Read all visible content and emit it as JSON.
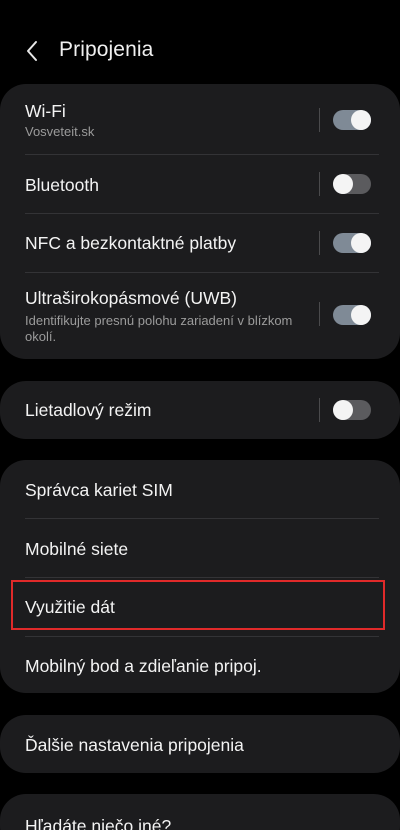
{
  "header": {
    "title": "Pripojenia",
    "back_icon": "chevron-left-icon"
  },
  "group1": {
    "wifi": {
      "label": "Wi-Fi",
      "subtitle": "Vosveteit.sk",
      "toggle": true
    },
    "bluetooth": {
      "label": "Bluetooth",
      "toggle": false
    },
    "nfc": {
      "label": "NFC a bezkontaktné platby",
      "toggle": true
    },
    "uwb": {
      "label": "Ultraširokopásmové (UWB)",
      "subtitle_line1": "Identifikujte presnú polohu zariadení v blízkom",
      "subtitle_line2": "okolí.",
      "toggle": true
    }
  },
  "group2": {
    "airplane": {
      "label": "Lietadlový režim",
      "toggle": false
    }
  },
  "group3": {
    "items": [
      {
        "label": "Správca kariet SIM"
      },
      {
        "label": "Mobilné siete"
      },
      {
        "label": "Využitie dát",
        "highlighted": true
      },
      {
        "label": "Mobilný bod a zdieľanie pripoj."
      }
    ]
  },
  "group4": {
    "more": {
      "label": "Ďalšie nastavenia pripojenia"
    }
  },
  "group5": {
    "looking": {
      "label": "Hľadáte niečo iné?"
    }
  },
  "colors": {
    "background": "#000000",
    "card": "#1c1c1e",
    "toggle_on": "#7f8a96",
    "toggle_off": "#5b5b5e",
    "highlight": "#e02a2a"
  }
}
